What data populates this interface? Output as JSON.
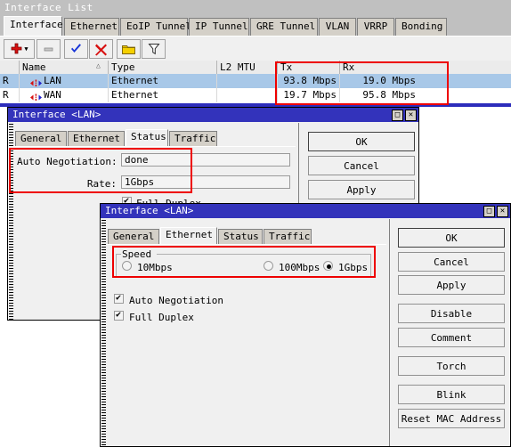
{
  "main_window": {
    "title": "Interface List",
    "tabs": [
      {
        "label": "Interface",
        "active": true
      },
      {
        "label": "Ethernet",
        "active": false
      },
      {
        "label": "EoIP Tunnel",
        "active": false
      },
      {
        "label": "IP Tunnel",
        "active": false
      },
      {
        "label": "GRE Tunnel",
        "active": false
      },
      {
        "label": "VLAN",
        "active": false
      },
      {
        "label": "VRRP",
        "active": false
      },
      {
        "label": "Bonding",
        "active": false
      }
    ],
    "toolbar": [
      {
        "name": "add-button",
        "icon": "plus-icon"
      },
      {
        "name": "remove-button",
        "icon": "minus-icon"
      },
      {
        "name": "enable-button",
        "icon": "check-icon"
      },
      {
        "name": "disable-button",
        "icon": "cross-icon"
      },
      {
        "name": "comment-button",
        "icon": "folder-icon"
      },
      {
        "name": "filter-button",
        "icon": "funnel-icon"
      }
    ],
    "table": {
      "columns": [
        "",
        "Name",
        "Type",
        "L2 MTU",
        "Tx",
        "Rx"
      ],
      "sort_indicator": "△",
      "rows": [
        {
          "flag": "R",
          "name": "LAN",
          "type": "Ethernet",
          "l2mtu": "",
          "tx": "93.8 Mbps",
          "rx": "19.0 Mbps",
          "selected": true
        },
        {
          "flag": "R",
          "name": "WAN",
          "type": "Ethernet",
          "l2mtu": "",
          "tx": "19.7 Mbps",
          "rx": "95.8 Mbps",
          "selected": false
        }
      ]
    }
  },
  "dialog_status": {
    "title": "Interface <LAN>",
    "window_buttons": {
      "maximize": "□",
      "close": "✕"
    },
    "tabs": [
      {
        "label": "General",
        "active": false
      },
      {
        "label": "Ethernet",
        "active": false
      },
      {
        "label": "Status",
        "active": true
      },
      {
        "label": "Traffic",
        "active": false
      }
    ],
    "fields": [
      {
        "label": "Auto Negotiation:",
        "value": "done"
      },
      {
        "label": "Rate:",
        "value": "1Gbps"
      }
    ],
    "checkbox": {
      "label": "Full Duplex",
      "checked": true
    },
    "buttons": [
      {
        "label": "OK",
        "default": true
      },
      {
        "label": "Cancel",
        "default": false
      },
      {
        "label": "Apply",
        "default": false
      }
    ]
  },
  "dialog_ethernet": {
    "title": "Interface <LAN>",
    "window_buttons": {
      "maximize": "□",
      "close": "✕"
    },
    "tabs": [
      {
        "label": "General",
        "active": false
      },
      {
        "label": "Ethernet",
        "active": true
      },
      {
        "label": "Status",
        "active": false
      },
      {
        "label": "Traffic",
        "active": false
      }
    ],
    "speed_group": {
      "legend": "Speed",
      "options": [
        {
          "label": "10Mbps",
          "selected": false
        },
        {
          "label": "100Mbps",
          "selected": false
        },
        {
          "label": "1Gbps",
          "selected": true
        }
      ]
    },
    "checkboxes": [
      {
        "label": "Auto Negotiation",
        "checked": true
      },
      {
        "label": "Full Duplex",
        "checked": true
      }
    ],
    "buttons": [
      {
        "label": "OK",
        "default": true
      },
      {
        "label": "Cancel",
        "default": false
      },
      {
        "label": "Apply",
        "default": false
      },
      {
        "label": "Disable",
        "default": false
      },
      {
        "label": "Comment",
        "default": false
      },
      {
        "label": "Torch",
        "default": false
      },
      {
        "label": "Blink",
        "default": false
      },
      {
        "label": "Reset MAC Address",
        "default": false
      }
    ]
  },
  "annotations": {
    "highlight_color": "#ee0000",
    "boxes": [
      "traffic-rates",
      "status-rate-fields",
      "speed-selection"
    ]
  }
}
